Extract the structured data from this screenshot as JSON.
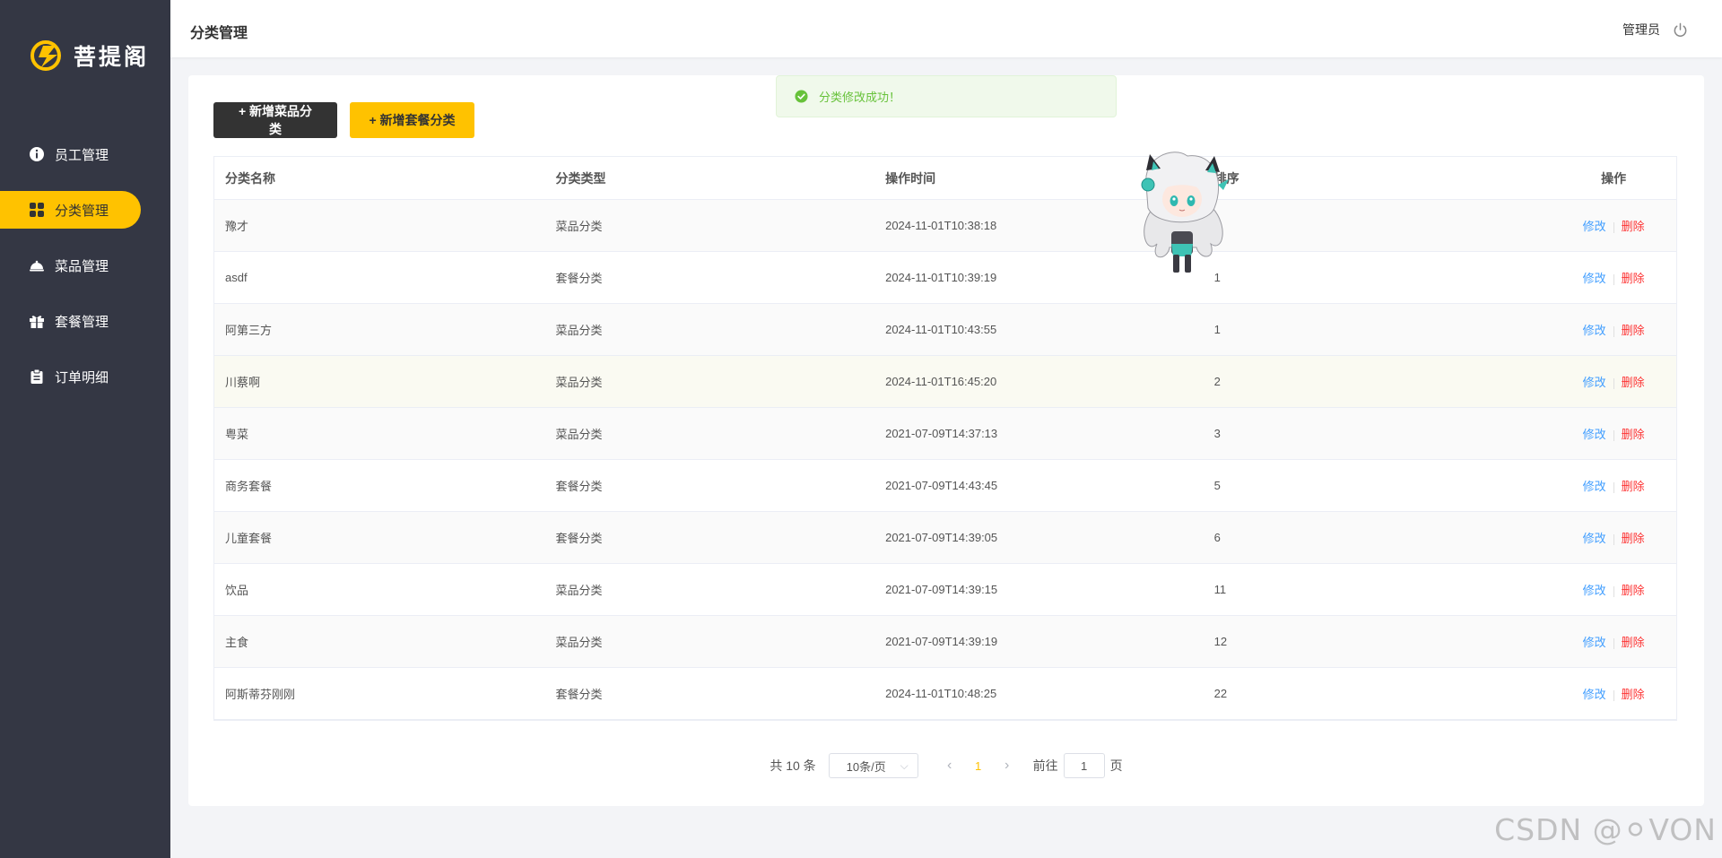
{
  "app": {
    "logo_text": "菩提阁"
  },
  "colors": {
    "sidebar_bg": "#343744",
    "accent": "#ffc200",
    "dark_button": "#333333",
    "edit_link": "#419eff",
    "delete_link": "#fd3333",
    "success": "#67c23a"
  },
  "sidebar": {
    "items": [
      {
        "label": "员工管理",
        "icon": "info-circle-icon",
        "active": false
      },
      {
        "label": "分类管理",
        "icon": "grid-icon",
        "active": true
      },
      {
        "label": "菜品管理",
        "icon": "dish-cloche-icon",
        "active": false
      },
      {
        "label": "套餐管理",
        "icon": "gift-icon",
        "active": false
      },
      {
        "label": "订单明细",
        "icon": "clipboard-icon",
        "active": false
      }
    ]
  },
  "header": {
    "title": "分类管理",
    "user": "管理员",
    "logout_icon": "power-icon"
  },
  "toolbar": {
    "add_dish_category": "+ 新增菜品分类",
    "add_setmeal_category": "+ 新增套餐分类"
  },
  "toast": {
    "message": "分类修改成功！",
    "icon": "check-circle-icon"
  },
  "table": {
    "columns": [
      "分类名称",
      "分类类型",
      "操作时间",
      "排序",
      "操作"
    ],
    "edit_label": "修改",
    "delete_label": "删除",
    "rows": [
      {
        "name": "豫才",
        "type": "菜品分类",
        "time": "2024-11-01T10:38:18",
        "sort": ""
      },
      {
        "name": "asdf",
        "type": "套餐分类",
        "time": "2024-11-01T10:39:19",
        "sort": "1"
      },
      {
        "name": "阿第三方",
        "type": "菜品分类",
        "time": "2024-11-01T10:43:55",
        "sort": "1"
      },
      {
        "name": "川蔡啊",
        "type": "菜品分类",
        "time": "2024-11-01T16:45:20",
        "sort": "2"
      },
      {
        "name": "粤菜",
        "type": "菜品分类",
        "time": "2021-07-09T14:37:13",
        "sort": "3"
      },
      {
        "name": "商务套餐",
        "type": "套餐分类",
        "time": "2021-07-09T14:43:45",
        "sort": "5"
      },
      {
        "name": "儿童套餐",
        "type": "套餐分类",
        "time": "2021-07-09T14:39:05",
        "sort": "6"
      },
      {
        "name": "饮品",
        "type": "菜品分类",
        "time": "2021-07-09T14:39:15",
        "sort": "11"
      },
      {
        "name": "主食",
        "type": "菜品分类",
        "time": "2021-07-09T14:39:19",
        "sort": "12"
      },
      {
        "name": "阿斯蒂芬刚刚",
        "type": "套餐分类",
        "time": "2024-11-01T10:48:25",
        "sort": "22"
      }
    ]
  },
  "pagination": {
    "total_text": "共 10 条",
    "page_size": "10条/页",
    "current_page": "1",
    "goto_label": "前往",
    "goto_value": "1",
    "page_suffix": "页"
  },
  "watermark": "CSDN @⚪VON"
}
